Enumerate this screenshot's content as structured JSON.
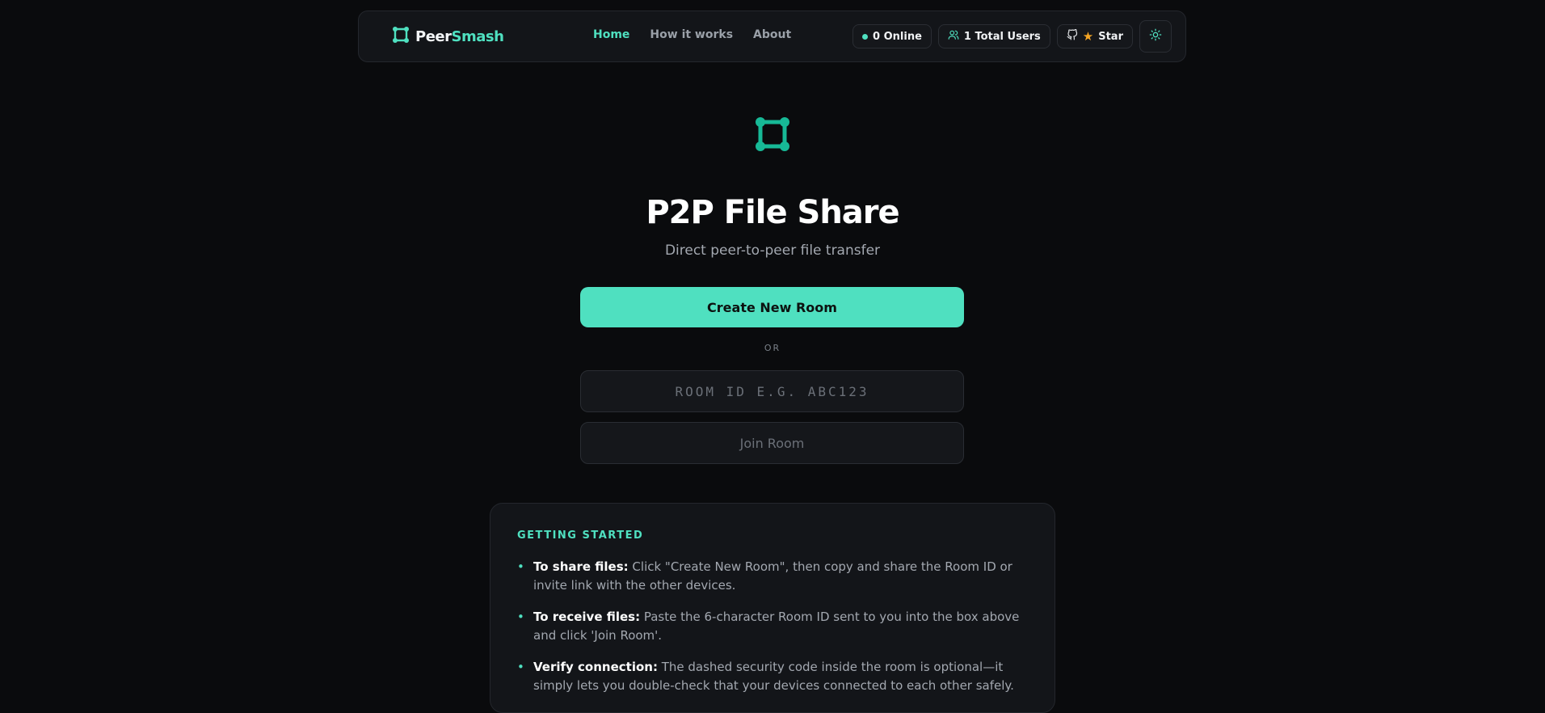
{
  "brand": {
    "part1": "Peer",
    "part2": "Smash",
    "accent": "#4fe0c0"
  },
  "nav": {
    "links": [
      {
        "label": "Home",
        "active": true
      },
      {
        "label": "How it works",
        "active": false
      },
      {
        "label": "About",
        "active": false
      }
    ],
    "online": "0 Online",
    "total_users": "1 Total Users",
    "star": "Star",
    "theme_icon": "sun-icon"
  },
  "hero": {
    "title": "P2P File Share",
    "subtitle": "Direct peer-to-peer file transfer",
    "create_label": "Create New Room",
    "or_label": "OR",
    "room_input": {
      "value": "",
      "placeholder": "Room ID e.g. ABC123"
    },
    "join_label": "Join Room"
  },
  "getting_started": {
    "title": "GETTING STARTED",
    "items": [
      {
        "bold": "To share files:",
        "text": " Click \"Create New Room\", then copy and share the Room ID or invite link with the other devices."
      },
      {
        "bold": "To receive files:",
        "text": " Paste the 6-character Room ID sent to you into the box above and click 'Join Room'."
      },
      {
        "bold": "Verify connection:",
        "text": " The dashed security code inside the room is optional—it simply lets you double-check that your devices connected to each other safely."
      }
    ]
  }
}
